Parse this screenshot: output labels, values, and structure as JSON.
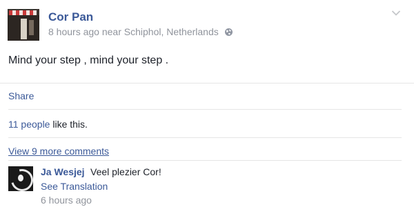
{
  "post": {
    "author": "Cor Pan",
    "time": "8 hours ago",
    "location_prefix": "near",
    "location": "Schiphol, Netherlands",
    "privacy_icon": "globe-icon",
    "menu_icon": "chevron-down-icon",
    "message": "Mind your step , mind your step ."
  },
  "actions": {
    "share_label": "Share"
  },
  "likes": {
    "count_link": "11 people",
    "suffix": "like this."
  },
  "comments": {
    "more_link": "View 9 more comments",
    "items": [
      {
        "author": "Ja Wesjej",
        "text": "Veel plezier Cor!",
        "translate_label": "See Translation",
        "time": "6 hours ago"
      }
    ]
  },
  "colors": {
    "link": "#3b5998",
    "text": "#1d2129",
    "meta": "#90949c",
    "divider": "#e5e5e5"
  }
}
